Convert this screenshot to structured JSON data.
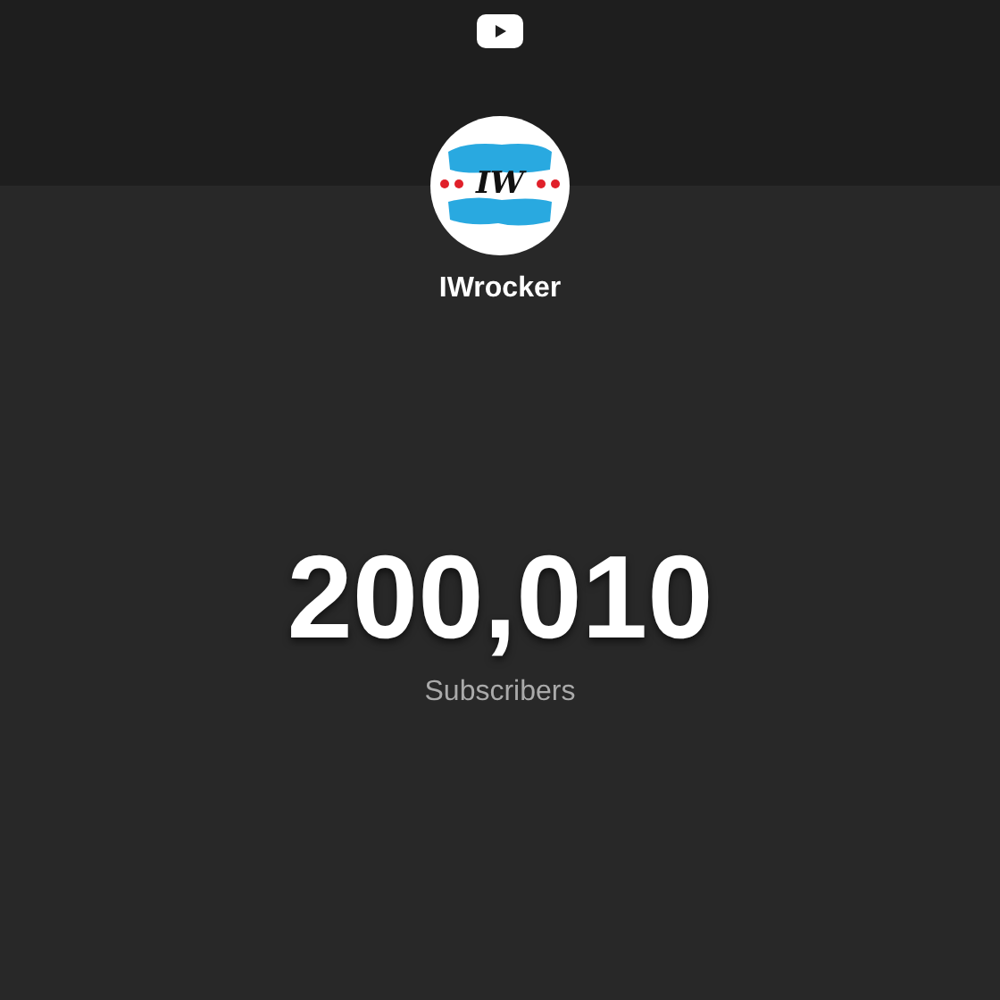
{
  "channel": {
    "logo_text": "IW",
    "name": "IWrocker"
  },
  "counter": {
    "value": "200,010",
    "label": "Subscribers"
  }
}
